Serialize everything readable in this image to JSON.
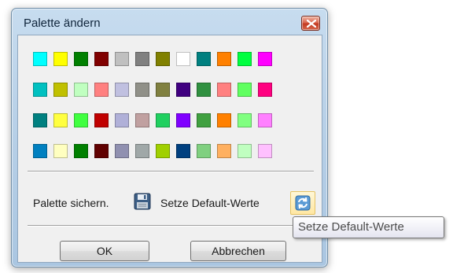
{
  "window": {
    "title": "Palette ändern",
    "close_icon": "close-icon"
  },
  "palette": {
    "rows": [
      [
        "#00ffff",
        "#ffff00",
        "#008000",
        "#800000",
        "#c0c0c0",
        "#808080",
        "#808000",
        "#ffffff",
        "#008080",
        "#ff8000",
        "#00ff40",
        "#ff00ff"
      ],
      [
        "#00c0c0",
        "#c0c000",
        "#c0ffc0",
        "#ff8080",
        "#c0c0e0",
        "#909088",
        "#808040",
        "#400080",
        "#309040",
        "#ff8080",
        "#60ff60",
        "#ff0080"
      ],
      [
        "#008080",
        "#ffff40",
        "#40ff40",
        "#c00000",
        "#b0b0d8",
        "#c0a0a0",
        "#20d060",
        "#8000ff",
        "#40a040",
        "#ff8000",
        "#80ff80",
        "#ff80ff"
      ],
      [
        "#0080c0",
        "#ffffc0",
        "#008000",
        "#600000",
        "#9090b0",
        "#a0a8a8",
        "#a0d000",
        "#004080",
        "#80d080",
        "#ffb060",
        "#c0ffc0",
        "#ffc0ff"
      ]
    ]
  },
  "actions": {
    "save_label": "Palette sichern.",
    "save_icon": "floppy-disk-icon",
    "default_label": "Setze Default-Werte",
    "default_icon": "refresh-icon"
  },
  "buttons": {
    "ok": "OK",
    "cancel": "Abbrechen"
  },
  "tooltip": {
    "text": "Setze Default-Werte"
  }
}
